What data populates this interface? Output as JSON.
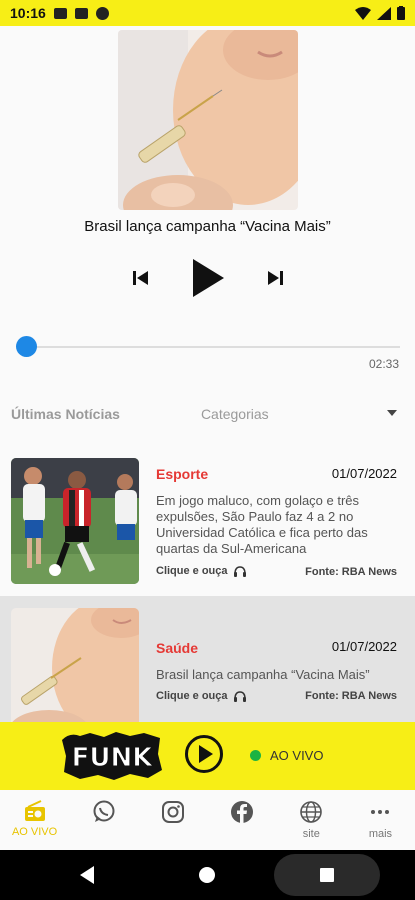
{
  "status_bar": {
    "time": "10:16"
  },
  "player": {
    "track_title": "Brasil lança campanha “Vacina Mais”",
    "duration": "02:33",
    "progress_fraction": 0.0
  },
  "tabs": {
    "latest_news": "Últimas Notícias",
    "categories": "Categorias"
  },
  "news": [
    {
      "category": "Esporte",
      "date": "01/07/2022",
      "headline": "Em jogo maluco, com golaço e três expulsões, São Paulo faz 4 a 2 no Universidad Católica e fica perto das quartas da Sul-Americana",
      "listen_label": "Clique e ouça",
      "source": "Fonte: RBA News"
    },
    {
      "category": "Saúde",
      "date": "01/07/2022",
      "headline": "Brasil lança campanha “Vacina Mais”",
      "listen_label": "Clique e ouça",
      "source": "Fonte: RBA News"
    }
  ],
  "live_bar": {
    "logo_text": "FUNK",
    "status": "AO VIVO",
    "accent": "#f7ee16",
    "live_dot_color": "#1db342"
  },
  "bottom_nav": {
    "items": [
      {
        "icon": "radio-icon",
        "label": "AO VIVO"
      },
      {
        "icon": "whatsapp-icon",
        "label": ""
      },
      {
        "icon": "instagram-icon",
        "label": ""
      },
      {
        "icon": "facebook-icon",
        "label": ""
      },
      {
        "icon": "globe-icon",
        "label": "site"
      },
      {
        "icon": "more-icon",
        "label": "mais"
      }
    ]
  },
  "colors": {
    "category_red": "#e53935",
    "progress_blue": "#1e88e5"
  }
}
